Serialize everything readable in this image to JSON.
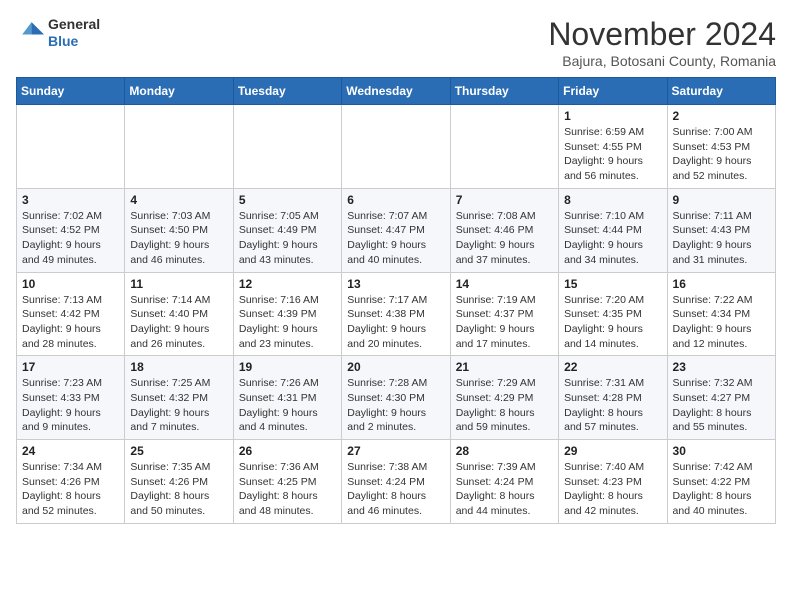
{
  "logo": {
    "general": "General",
    "blue": "Blue"
  },
  "header": {
    "month": "November 2024",
    "location": "Bajura, Botosani County, Romania"
  },
  "weekdays": [
    "Sunday",
    "Monday",
    "Tuesday",
    "Wednesday",
    "Thursday",
    "Friday",
    "Saturday"
  ],
  "weeks": [
    [
      {
        "day": "",
        "info": ""
      },
      {
        "day": "",
        "info": ""
      },
      {
        "day": "",
        "info": ""
      },
      {
        "day": "",
        "info": ""
      },
      {
        "day": "",
        "info": ""
      },
      {
        "day": "1",
        "info": "Sunrise: 6:59 AM\nSunset: 4:55 PM\nDaylight: 9 hours and 56 minutes."
      },
      {
        "day": "2",
        "info": "Sunrise: 7:00 AM\nSunset: 4:53 PM\nDaylight: 9 hours and 52 minutes."
      }
    ],
    [
      {
        "day": "3",
        "info": "Sunrise: 7:02 AM\nSunset: 4:52 PM\nDaylight: 9 hours and 49 minutes."
      },
      {
        "day": "4",
        "info": "Sunrise: 7:03 AM\nSunset: 4:50 PM\nDaylight: 9 hours and 46 minutes."
      },
      {
        "day": "5",
        "info": "Sunrise: 7:05 AM\nSunset: 4:49 PM\nDaylight: 9 hours and 43 minutes."
      },
      {
        "day": "6",
        "info": "Sunrise: 7:07 AM\nSunset: 4:47 PM\nDaylight: 9 hours and 40 minutes."
      },
      {
        "day": "7",
        "info": "Sunrise: 7:08 AM\nSunset: 4:46 PM\nDaylight: 9 hours and 37 minutes."
      },
      {
        "day": "8",
        "info": "Sunrise: 7:10 AM\nSunset: 4:44 PM\nDaylight: 9 hours and 34 minutes."
      },
      {
        "day": "9",
        "info": "Sunrise: 7:11 AM\nSunset: 4:43 PM\nDaylight: 9 hours and 31 minutes."
      }
    ],
    [
      {
        "day": "10",
        "info": "Sunrise: 7:13 AM\nSunset: 4:42 PM\nDaylight: 9 hours and 28 minutes."
      },
      {
        "day": "11",
        "info": "Sunrise: 7:14 AM\nSunset: 4:40 PM\nDaylight: 9 hours and 26 minutes."
      },
      {
        "day": "12",
        "info": "Sunrise: 7:16 AM\nSunset: 4:39 PM\nDaylight: 9 hours and 23 minutes."
      },
      {
        "day": "13",
        "info": "Sunrise: 7:17 AM\nSunset: 4:38 PM\nDaylight: 9 hours and 20 minutes."
      },
      {
        "day": "14",
        "info": "Sunrise: 7:19 AM\nSunset: 4:37 PM\nDaylight: 9 hours and 17 minutes."
      },
      {
        "day": "15",
        "info": "Sunrise: 7:20 AM\nSunset: 4:35 PM\nDaylight: 9 hours and 14 minutes."
      },
      {
        "day": "16",
        "info": "Sunrise: 7:22 AM\nSunset: 4:34 PM\nDaylight: 9 hours and 12 minutes."
      }
    ],
    [
      {
        "day": "17",
        "info": "Sunrise: 7:23 AM\nSunset: 4:33 PM\nDaylight: 9 hours and 9 minutes."
      },
      {
        "day": "18",
        "info": "Sunrise: 7:25 AM\nSunset: 4:32 PM\nDaylight: 9 hours and 7 minutes."
      },
      {
        "day": "19",
        "info": "Sunrise: 7:26 AM\nSunset: 4:31 PM\nDaylight: 9 hours and 4 minutes."
      },
      {
        "day": "20",
        "info": "Sunrise: 7:28 AM\nSunset: 4:30 PM\nDaylight: 9 hours and 2 minutes."
      },
      {
        "day": "21",
        "info": "Sunrise: 7:29 AM\nSunset: 4:29 PM\nDaylight: 8 hours and 59 minutes."
      },
      {
        "day": "22",
        "info": "Sunrise: 7:31 AM\nSunset: 4:28 PM\nDaylight: 8 hours and 57 minutes."
      },
      {
        "day": "23",
        "info": "Sunrise: 7:32 AM\nSunset: 4:27 PM\nDaylight: 8 hours and 55 minutes."
      }
    ],
    [
      {
        "day": "24",
        "info": "Sunrise: 7:34 AM\nSunset: 4:26 PM\nDaylight: 8 hours and 52 minutes."
      },
      {
        "day": "25",
        "info": "Sunrise: 7:35 AM\nSunset: 4:26 PM\nDaylight: 8 hours and 50 minutes."
      },
      {
        "day": "26",
        "info": "Sunrise: 7:36 AM\nSunset: 4:25 PM\nDaylight: 8 hours and 48 minutes."
      },
      {
        "day": "27",
        "info": "Sunrise: 7:38 AM\nSunset: 4:24 PM\nDaylight: 8 hours and 46 minutes."
      },
      {
        "day": "28",
        "info": "Sunrise: 7:39 AM\nSunset: 4:24 PM\nDaylight: 8 hours and 44 minutes."
      },
      {
        "day": "29",
        "info": "Sunrise: 7:40 AM\nSunset: 4:23 PM\nDaylight: 8 hours and 42 minutes."
      },
      {
        "day": "30",
        "info": "Sunrise: 7:42 AM\nSunset: 4:22 PM\nDaylight: 8 hours and 40 minutes."
      }
    ]
  ]
}
